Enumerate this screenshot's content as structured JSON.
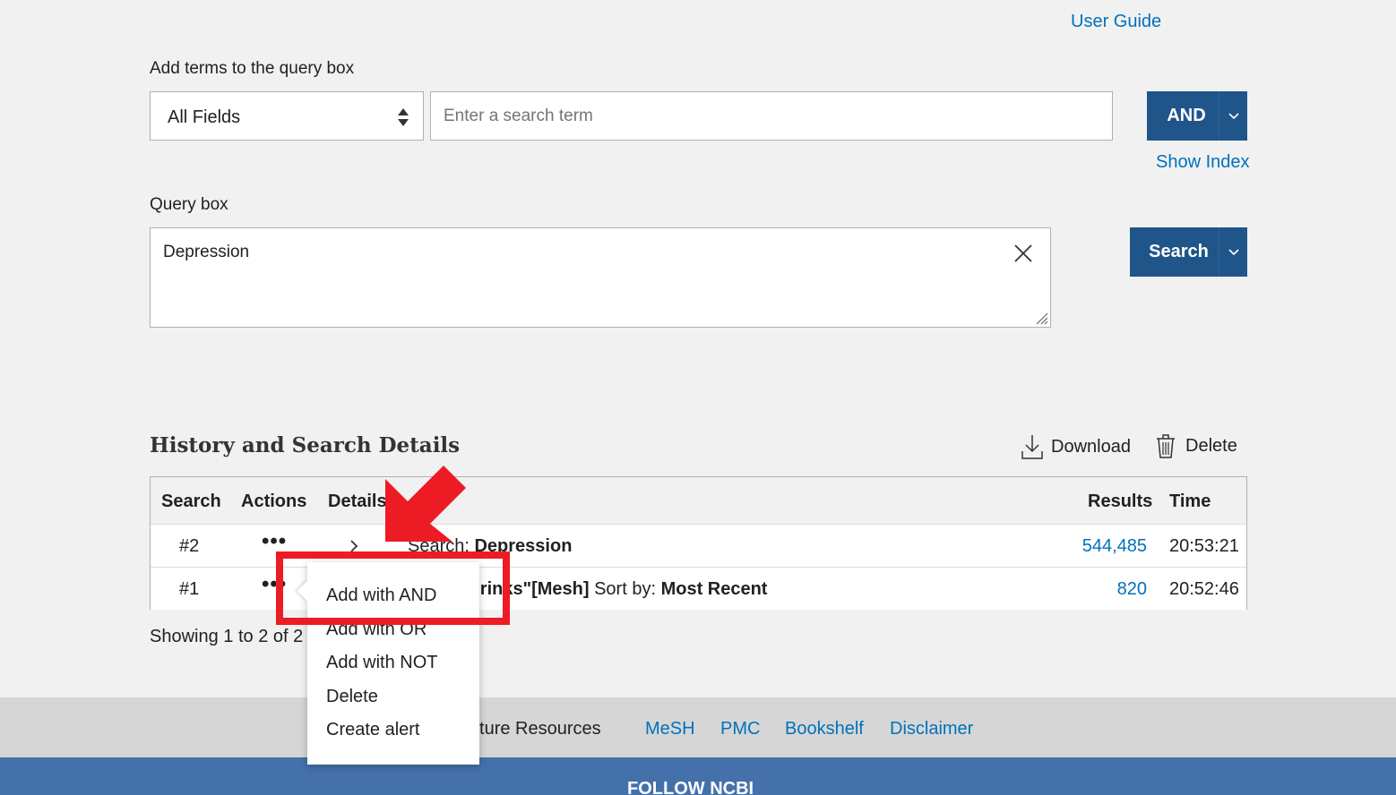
{
  "header": {
    "user_guide": "User Guide"
  },
  "builder": {
    "add_terms_label": "Add terms to the query box",
    "field_select_value": "All Fields",
    "term_placeholder": "Enter a search term",
    "and_label": "AND",
    "show_index": "Show Index",
    "query_label": "Query box",
    "query_value": "Depression",
    "search_label": "Search"
  },
  "history": {
    "title": "History and Search Details",
    "download": "Download",
    "delete": "Delete",
    "columns": [
      "Search",
      "Actions",
      "Details",
      "Results",
      "Time"
    ],
    "rows": [
      {
        "num": "#2",
        "actions": "•••",
        "query_prefix": "Search: ",
        "query": "Depression",
        "results": "544,485",
        "time": "20:53:21"
      },
      {
        "num": "#1",
        "actions": "•••",
        "query_prefix": "",
        "query": "Energy Drinks\"[Mesh]",
        "sort_prefix": " Sort by: ",
        "sort": "Most Recent",
        "results": "820",
        "time": "20:52:46"
      }
    ],
    "showing": "Showing 1 to 2 of 2"
  },
  "actions_menu": {
    "items": [
      "Add with AND",
      "Add with OR",
      "Add with NOT",
      "Delete",
      "Create alert"
    ]
  },
  "footer": {
    "links": [
      "Literature Resources",
      "MeSH",
      "PMC",
      "Bookshelf",
      "Disclaimer"
    ],
    "follow": "FOLLOW NCBI"
  },
  "annotation": {
    "highlight_color": "#ed1c24"
  },
  "colors": {
    "primary": "#20558a",
    "link": "#0071bc",
    "footer_blue": "#4471a9"
  }
}
